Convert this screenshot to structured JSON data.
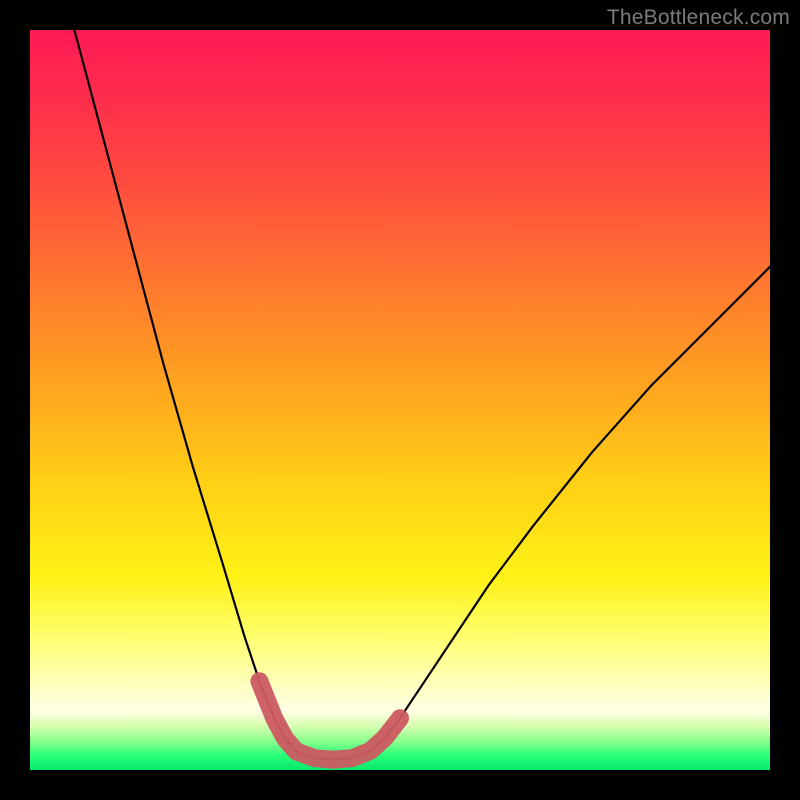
{
  "watermark": "TheBottleneck.com",
  "chart_data": {
    "type": "line",
    "title": "",
    "xlabel": "",
    "ylabel": "",
    "xlim": [
      0,
      100
    ],
    "ylim": [
      0,
      100
    ],
    "note": "Values estimated from pixel positions; chart has no axis ticks. x is horizontal (0=left,100=right of plot area), y is height (0=bottom,100=top).",
    "series": [
      {
        "name": "black-curve",
        "style": "thin-black",
        "x": [
          6,
          10,
          14,
          18,
          22,
          26,
          29,
          31,
          33,
          34.5,
          36,
          38.5,
          41,
          43.5,
          46,
          48,
          50,
          54,
          58,
          62,
          68,
          76,
          84,
          92,
          100
        ],
        "y": [
          100,
          85,
          70,
          55,
          41,
          28,
          18,
          12,
          7,
          4.2,
          2.5,
          1.6,
          1.4,
          1.6,
          2.6,
          4.4,
          7,
          13,
          19,
          25,
          33,
          43,
          52,
          60,
          68
        ]
      },
      {
        "name": "red-band",
        "style": "thick-red",
        "x": [
          31,
          33,
          34.5,
          36,
          38.5,
          41,
          43.5,
          46,
          48,
          50
        ],
        "y": [
          12,
          7,
          4.2,
          2.5,
          1.6,
          1.4,
          1.6,
          2.6,
          4.4,
          7
        ]
      }
    ],
    "background_gradient": {
      "direction": "vertical",
      "stops": [
        {
          "pos": 0,
          "color": "#ff1b55"
        },
        {
          "pos": 35,
          "color": "#ff7a2e"
        },
        {
          "pos": 62,
          "color": "#ffd215"
        },
        {
          "pos": 88,
          "color": "#ffffb8"
        },
        {
          "pos": 100,
          "color": "#07e86d"
        }
      ]
    }
  }
}
